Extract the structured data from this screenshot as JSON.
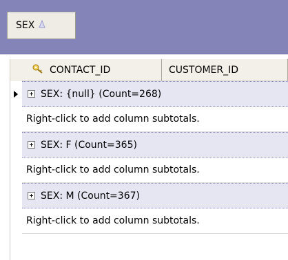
{
  "group_panel": {
    "chip_label": "SEX",
    "sort_icon": "sort-ascending-icon"
  },
  "columns": [
    {
      "label": "CONTACT_ID",
      "icon": "key-icon"
    },
    {
      "label": "CUSTOMER_ID"
    }
  ],
  "groups": [
    {
      "label": "SEX: {null} (Count=268)",
      "footer": "Right-click to add column subtotals.",
      "current": true
    },
    {
      "label": "SEX: F (Count=365)",
      "footer": "Right-click to add column subtotals."
    },
    {
      "label": "SEX: M (Count=367)",
      "footer": "Right-click to add column subtotals."
    }
  ],
  "colors": {
    "group_panel_bg": "#8584b8",
    "group_row_bg": "#e6e6f3"
  }
}
